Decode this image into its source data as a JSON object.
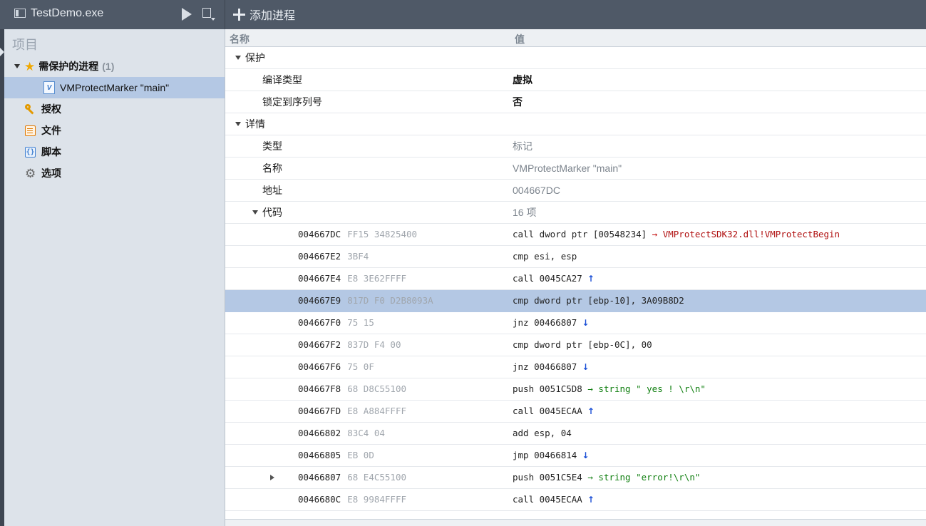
{
  "toolbar": {
    "app_title": "TestDemo.exe",
    "add_process_label": "添加进程"
  },
  "sidebar": {
    "heading": "项目",
    "protected_label": "需保护的进程",
    "protected_count": "(1)",
    "marker_item": "VMProtectMarker \"main\"",
    "licenses": "授权",
    "files": "文件",
    "scripts": "脚本",
    "options": "选项"
  },
  "grid": {
    "col_name": "名称",
    "col_value": "值",
    "protection": {
      "label": "保护",
      "compile_type_label": "编译类型",
      "compile_type_value": "虚拟",
      "lock_serial_label": "锁定到序列号",
      "lock_serial_value": "否"
    },
    "details": {
      "label": "详情",
      "type_label": "类型",
      "type_value": "标记",
      "name_label": "名称",
      "name_value": "VMProtectMarker \"main\"",
      "address_label": "地址",
      "address_value": "004667DC",
      "code_label": "代码",
      "code_value": "16 项"
    },
    "code_rows": [
      {
        "addr": "004667DC",
        "bytes": "FF15 34825400",
        "ins": "call dword ptr [00548234]",
        "arrow": "→",
        "target": "VMProtectSDK32.dll!VMProtectBegin",
        "kind": "sym"
      },
      {
        "addr": "004667E2",
        "bytes": "3BF4",
        "ins": "cmp esi, esp",
        "kind": "plain"
      },
      {
        "addr": "004667E4",
        "bytes": "E8 3E62FFFF",
        "ins": "call 0045CA27",
        "jump": "↑",
        "kind": "jump"
      },
      {
        "addr": "004667E9",
        "bytes": "817D F0 D2B8093A",
        "ins": "cmp dword ptr [ebp-10], 3A09B8D2",
        "kind": "plain",
        "selected": true
      },
      {
        "addr": "004667F0",
        "bytes": "75 15",
        "ins": "jnz 00466807",
        "jump": "↓",
        "kind": "jump"
      },
      {
        "addr": "004667F2",
        "bytes": "837D F4 00",
        "ins": "cmp dword ptr [ebp-0C], 00",
        "kind": "plain"
      },
      {
        "addr": "004667F6",
        "bytes": "75 0F",
        "ins": "jnz 00466807",
        "jump": "↓",
        "kind": "jump"
      },
      {
        "addr": "004667F8",
        "bytes": "68 D8C55100",
        "ins": "push 0051C5D8",
        "arrow": "→",
        "target": "string \" yes ! \\r\\n\"",
        "kind": "str"
      },
      {
        "addr": "004667FD",
        "bytes": "E8 A884FFFF",
        "ins": "call 0045ECAA",
        "jump": "↑",
        "kind": "jump"
      },
      {
        "addr": "00466802",
        "bytes": "83C4 04",
        "ins": "add esp, 04",
        "kind": "plain"
      },
      {
        "addr": "00466805",
        "bytes": "EB 0D",
        "ins": "jmp 00466814",
        "jump": "↓",
        "kind": "jump"
      },
      {
        "addr": "00466807",
        "bytes": "68 E4C55100",
        "ins": "push 0051C5E4",
        "arrow": "→",
        "target": "string \"error!\\r\\n\"",
        "kind": "str",
        "expandable": true
      },
      {
        "addr": "0046680C",
        "bytes": "E8 9984FFFF",
        "ins": "call 0045ECAA",
        "jump": "↑",
        "kind": "jump"
      }
    ]
  },
  "colors": {
    "toolbar_bg": "#4f5967",
    "sidebar_bg": "#dde3ea",
    "selection": "#b4c8e4",
    "star": "#f0a800",
    "string_green": "#128012",
    "symbol_red": "#b01010",
    "jump_blue": "#1a4fd6"
  }
}
